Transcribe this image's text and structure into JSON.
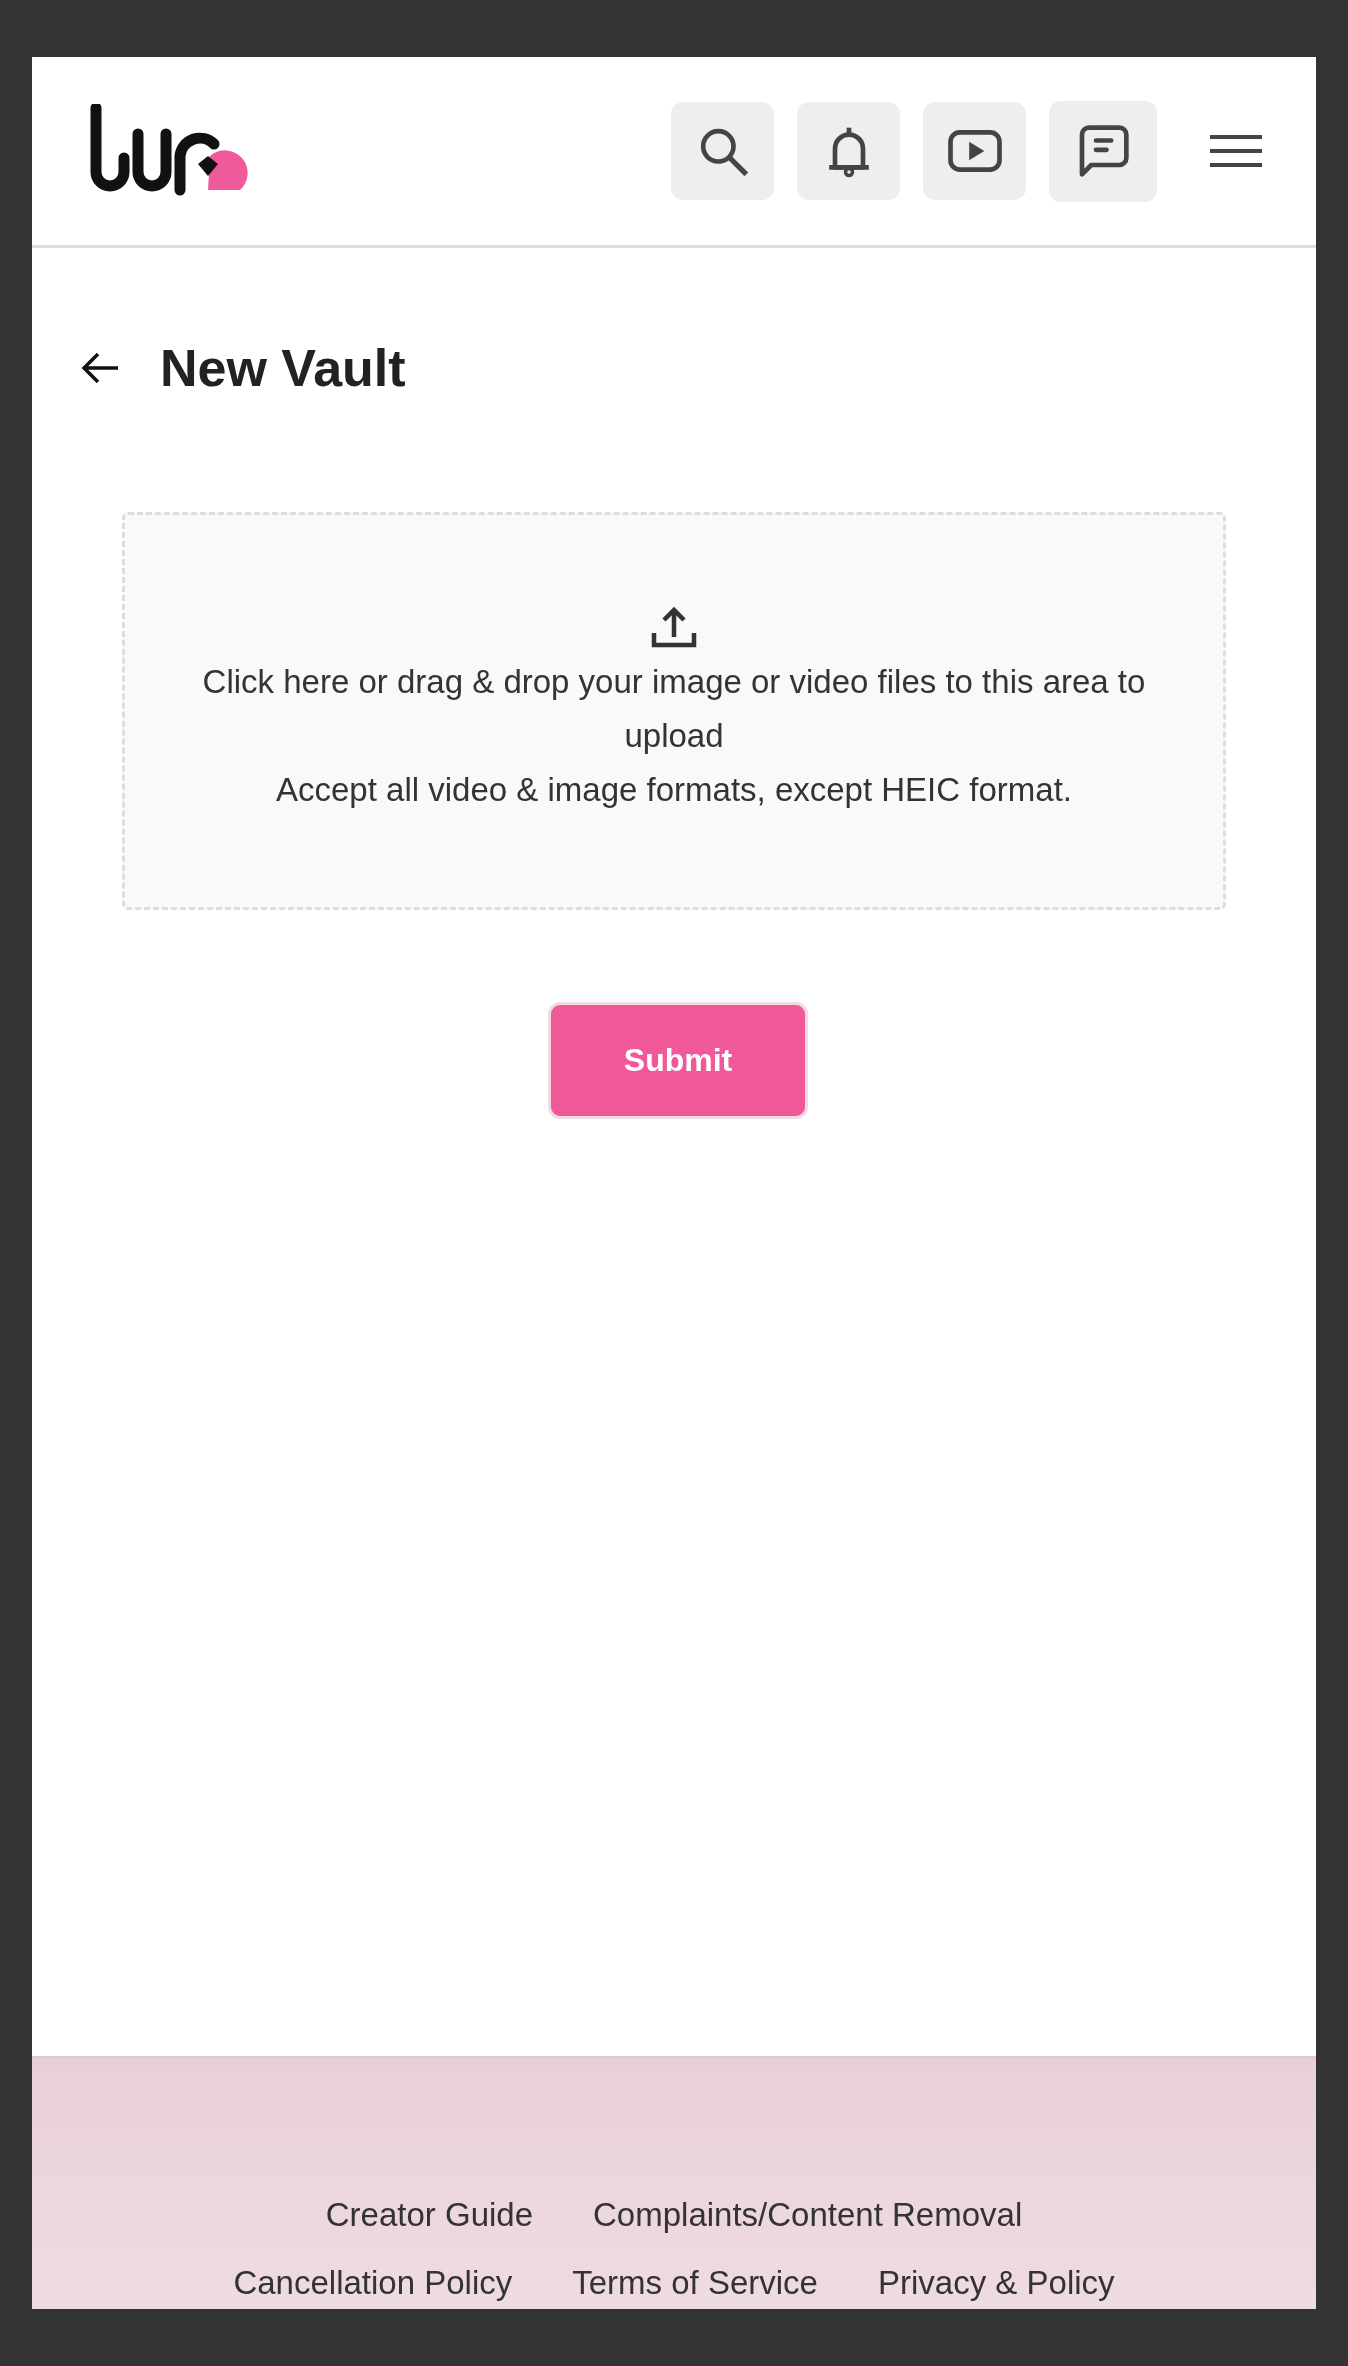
{
  "header": {
    "buttons": [
      {
        "kind": "search"
      },
      {
        "kind": "bell"
      },
      {
        "kind": "play"
      },
      {
        "kind": "chat"
      }
    ]
  },
  "page": {
    "title": "New Vault"
  },
  "upload": {
    "lines": [
      "Click here or drag & drop your image or video files to this area to upload",
      "Accept all video & image formats, except HEIC format."
    ]
  },
  "submit": "Submit",
  "footer": {
    "rows": [
      [
        "Creator Guide",
        "Complaints/Content Removal"
      ],
      [
        "Cancellation Policy",
        "Terms of Service",
        "Privacy & Policy"
      ]
    ]
  }
}
